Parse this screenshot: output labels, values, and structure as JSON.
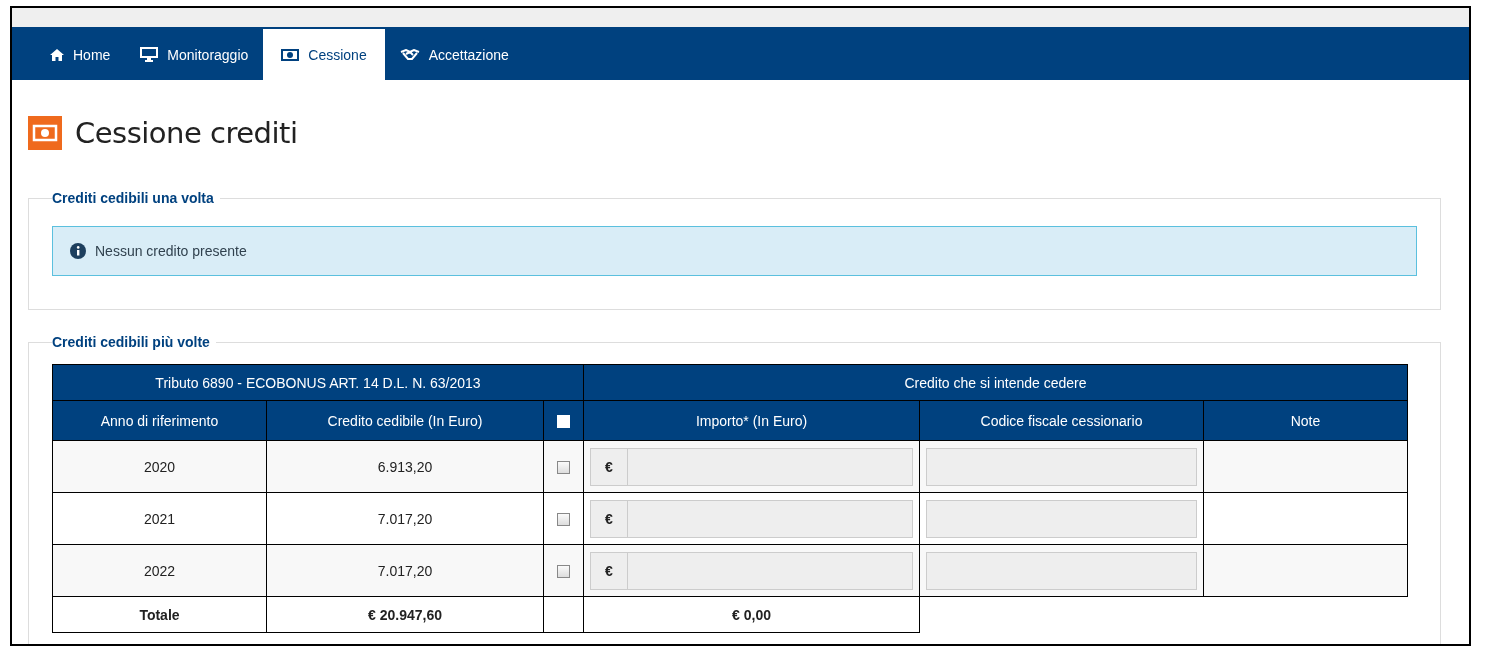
{
  "tabs": [
    {
      "label": "Home",
      "kind": "home",
      "selected": false
    },
    {
      "label": "Monitoraggio",
      "kind": "monitor",
      "selected": false
    },
    {
      "label": "Cessione",
      "kind": "money",
      "selected": true
    },
    {
      "label": "Accettazione",
      "kind": "handshake",
      "selected": false
    }
  ],
  "page_title": "Cessione crediti",
  "section_once": {
    "legend": "Crediti cedibili una volta",
    "alert": "Nessun credito presente"
  },
  "section_many": {
    "legend": "Crediti cedibili più volte",
    "table": {
      "group_headers": [
        "Tributo 6890 - ECOBONUS ART. 14 D.L. N. 63/2013",
        "Credito che si intende cedere"
      ],
      "columns": [
        "Anno di riferimento",
        "Credito cedibile (In Euro)",
        "Importo* (In Euro)",
        "Codice fiscale cessionario",
        "Note"
      ],
      "select_all": {
        "checked": false
      },
      "rows": [
        {
          "year": "2020",
          "credit": "6.913,20",
          "checked": false,
          "currency": "€"
        },
        {
          "year": "2021",
          "credit": "7.017,20",
          "checked": false,
          "currency": "€"
        },
        {
          "year": "2022",
          "credit": "7.017,20",
          "checked": false,
          "currency": "€"
        }
      ],
      "total": {
        "label": "Totale",
        "credit": "€  20.947,60",
        "amount": "€  0,00"
      }
    }
  }
}
